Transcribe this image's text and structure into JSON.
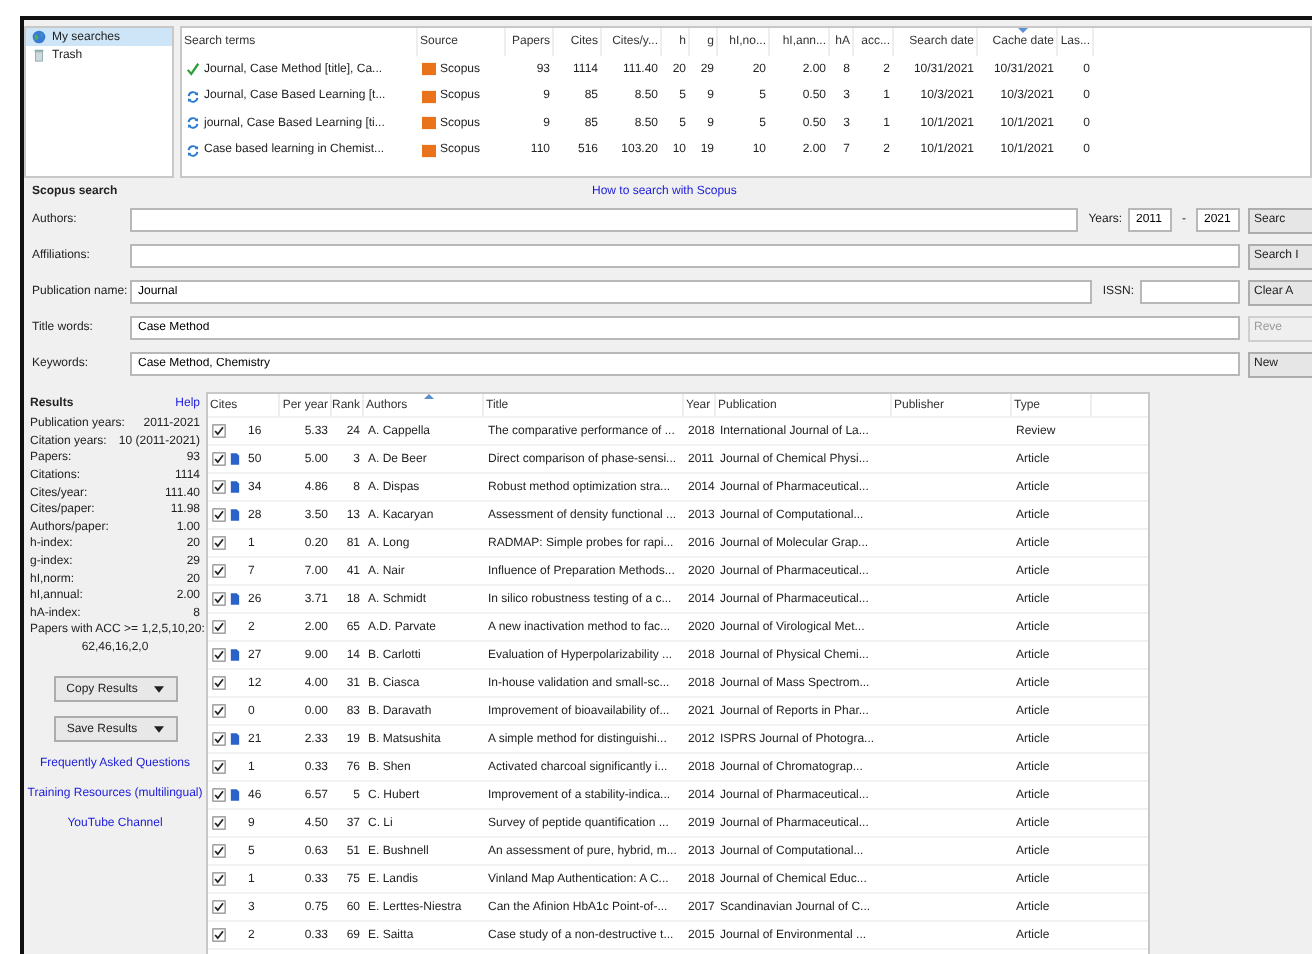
{
  "sidebar": {
    "items": [
      {
        "label": "My searches",
        "selected": true
      },
      {
        "label": "Trash",
        "selected": false
      }
    ]
  },
  "searches": {
    "columns": [
      {
        "label": "Search terms",
        "sorted": false
      },
      {
        "label": "Source",
        "sorted": false
      },
      {
        "label": "Papers",
        "sorted": false
      },
      {
        "label": "Cites",
        "sorted": false
      },
      {
        "label": "Cites/y...",
        "sorted": false
      },
      {
        "label": "h",
        "sorted": false
      },
      {
        "label": "g",
        "sorted": false
      },
      {
        "label": "hI,no...",
        "sorted": false
      },
      {
        "label": "hI,ann...",
        "sorted": false
      },
      {
        "label": "hA",
        "sorted": false
      },
      {
        "label": "acc...",
        "sorted": false
      },
      {
        "label": "Search date",
        "sorted": false
      },
      {
        "label": "Cache date",
        "sorted": true
      },
      {
        "label": "Las...",
        "sorted": false
      }
    ],
    "rows": [
      {
        "kind": "complete",
        "cells": [
          "Journal, Case Method [title], Ca...",
          "Scopus",
          "93",
          "1114",
          "111.40",
          "20",
          "29",
          "20",
          "2.00",
          "8",
          "2",
          "10/31/2021",
          "10/31/2021",
          "0"
        ]
      },
      {
        "kind": "cached",
        "cells": [
          "Journal, Case Based Learning [t...",
          "Scopus",
          "9",
          "85",
          "8.50",
          "5",
          "9",
          "5",
          "0.50",
          "3",
          "1",
          "10/3/2021",
          "10/3/2021",
          "0"
        ]
      },
      {
        "kind": "cached",
        "cells": [
          "journal, Case Based Learning [ti...",
          "Scopus",
          "9",
          "85",
          "8.50",
          "5",
          "9",
          "5",
          "0.50",
          "3",
          "1",
          "10/1/2021",
          "10/1/2021",
          "0"
        ]
      },
      {
        "kind": "cached",
        "cells": [
          "Case based learning in Chemist...",
          "Scopus",
          "110",
          "516",
          "103.20",
          "10",
          "19",
          "10",
          "2.00",
          "7",
          "2",
          "10/1/2021",
          "10/1/2021",
          "0"
        ]
      }
    ]
  },
  "search_form": {
    "title": "Scopus search",
    "help_link": "How to search with Scopus",
    "fields": [
      {
        "kind": "years",
        "label": "Authors:",
        "extra_label": "Years:",
        "from": "2011",
        "separator": "-",
        "to": "2021"
      },
      {
        "kind": "plain",
        "label": "Affiliations:"
      },
      {
        "kind": "issn",
        "label": "Publication name:",
        "value": "Journal",
        "extra_label": "ISSN:"
      },
      {
        "kind": "plain",
        "label": "Title words:",
        "value": "Case Method"
      },
      {
        "kind": "plain",
        "label": "Keywords:",
        "value": "Case Method, Chemistry"
      }
    ],
    "buttons": [
      {
        "label": "Searc",
        "disabled": false
      },
      {
        "label": "Search I",
        "disabled": false
      },
      {
        "label": "Clear A",
        "disabled": false
      },
      {
        "label": "Reve",
        "disabled": true
      },
      {
        "label": "New",
        "disabled": false
      }
    ]
  },
  "results": {
    "title": "Results",
    "help": "Help",
    "stats": [
      {
        "label": "Publication years:",
        "value": "2011-2021"
      },
      {
        "label": "Citation years:",
        "value": "10 (2011-2021)"
      },
      {
        "label": "Papers:",
        "value": "93"
      },
      {
        "label": "Citations:",
        "value": "1114"
      },
      {
        "label": "Cites/year:",
        "value": "111.40"
      },
      {
        "label": "Cites/paper:",
        "value": "11.98"
      },
      {
        "label": "Authors/paper:",
        "value": "1.00"
      },
      {
        "label": "h-index:",
        "value": "20"
      },
      {
        "label": "g-index:",
        "value": "29"
      },
      {
        "label": "hI,norm:",
        "value": "20"
      },
      {
        "label": "hI,annual:",
        "value": "2.00"
      },
      {
        "label": "hA-index:",
        "value": "8"
      }
    ],
    "acc": {
      "label": "Papers with ACC >= 1,2,5,10,20:",
      "value": "62,46,16,2,0"
    },
    "buttons": [
      "Copy Results",
      "Save Results"
    ],
    "links": [
      "Frequently Asked Questions",
      "Training Resources (multilingual)",
      "YouTube Channel"
    ],
    "columns": [
      {
        "label": "Cites",
        "sorted": false
      },
      {
        "label": "Per year",
        "sorted": false
      },
      {
        "label": "Rank",
        "sorted": false
      },
      {
        "label": "Authors",
        "sorted": true
      },
      {
        "label": "Title",
        "sorted": false
      },
      {
        "label": "Year",
        "sorted": false
      },
      {
        "label": "Publication",
        "sorted": false
      },
      {
        "label": "Publisher",
        "sorted": false
      },
      {
        "label": "Type",
        "sorted": false
      }
    ],
    "rows": [
      {
        "checked": true,
        "linked": false,
        "cites": "16",
        "per_year": "5.33",
        "rank": "24",
        "authors": "A. Cappella",
        "title": "The comparative performance of ...",
        "year": "2018",
        "publication": "International Journal of La...",
        "type": "Review"
      },
      {
        "checked": true,
        "linked": true,
        "cites": "50",
        "per_year": "5.00",
        "rank": "3",
        "authors": "A. De Beer",
        "title": "Direct comparison of phase-sensi...",
        "year": "2011",
        "publication": "Journal of Chemical Physi...",
        "type": "Article"
      },
      {
        "checked": true,
        "linked": true,
        "cites": "34",
        "per_year": "4.86",
        "rank": "8",
        "authors": "A. Dispas",
        "title": "Robust method optimization stra...",
        "year": "2014",
        "publication": "Journal of Pharmaceutical...",
        "type": "Article"
      },
      {
        "checked": true,
        "linked": true,
        "cites": "28",
        "per_year": "3.50",
        "rank": "13",
        "authors": "A. Kacaryan",
        "title": "Assessment of density functional ...",
        "year": "2013",
        "publication": "Journal of Computational...",
        "type": "Article"
      },
      {
        "checked": true,
        "linked": false,
        "cites": "1",
        "per_year": "0.20",
        "rank": "81",
        "authors": "A. Long",
        "title": "RADMAP: Simple probes for rapi...",
        "year": "2016",
        "publication": "Journal of Molecular Grap...",
        "type": "Article"
      },
      {
        "checked": true,
        "linked": false,
        "cites": "7",
        "per_year": "7.00",
        "rank": "41",
        "authors": "A. Nair",
        "title": "Influence of Preparation Methods...",
        "year": "2020",
        "publication": "Journal of Pharmaceutical...",
        "type": "Article"
      },
      {
        "checked": true,
        "linked": true,
        "cites": "26",
        "per_year": "3.71",
        "rank": "18",
        "authors": "A. Schmidt",
        "title": "In silico robustness testing of a c...",
        "year": "2014",
        "publication": "Journal of Pharmaceutical...",
        "type": "Article"
      },
      {
        "checked": true,
        "linked": false,
        "cites": "2",
        "per_year": "2.00",
        "rank": "65",
        "authors": "A.D. Parvate",
        "title": "A new inactivation method to fac...",
        "year": "2020",
        "publication": "Journal of Virological Met...",
        "type": "Article"
      },
      {
        "checked": true,
        "linked": true,
        "cites": "27",
        "per_year": "9.00",
        "rank": "14",
        "authors": "B. Carlotti",
        "title": "Evaluation of Hyperpolarizability ...",
        "year": "2018",
        "publication": "Journal of Physical Chemi...",
        "type": "Article"
      },
      {
        "checked": true,
        "linked": false,
        "cites": "12",
        "per_year": "4.00",
        "rank": "31",
        "authors": "B. Ciasca",
        "title": "In-house validation and small-sc...",
        "year": "2018",
        "publication": "Journal of Mass Spectrom...",
        "type": "Article"
      },
      {
        "checked": true,
        "linked": false,
        "cites": "0",
        "per_year": "0.00",
        "rank": "83",
        "authors": "B. Daravath",
        "title": "Improvement of bioavailability of...",
        "year": "2021",
        "publication": "Journal of Reports in Phar...",
        "type": "Article"
      },
      {
        "checked": true,
        "linked": true,
        "cites": "21",
        "per_year": "2.33",
        "rank": "19",
        "authors": "B. Matsushita",
        "title": "A simple method for distinguishi...",
        "year": "2012",
        "publication": "ISPRS Journal of Photogra...",
        "type": "Article"
      },
      {
        "checked": true,
        "linked": false,
        "cites": "1",
        "per_year": "0.33",
        "rank": "76",
        "authors": "B. Shen",
        "title": "Activated charcoal significantly i...",
        "year": "2018",
        "publication": "Journal of Chromatograp...",
        "type": "Article"
      },
      {
        "checked": true,
        "linked": true,
        "cites": "46",
        "per_year": "6.57",
        "rank": "5",
        "authors": "C. Hubert",
        "title": "Improvement of a stability-indica...",
        "year": "2014",
        "publication": "Journal of Pharmaceutical...",
        "type": "Article"
      },
      {
        "checked": true,
        "linked": false,
        "cites": "9",
        "per_year": "4.50",
        "rank": "37",
        "authors": "C. Li",
        "title": "Survey of peptide quantification ...",
        "year": "2019",
        "publication": "Journal of Pharmaceutical...",
        "type": "Article"
      },
      {
        "checked": true,
        "linked": false,
        "cites": "5",
        "per_year": "0.63",
        "rank": "51",
        "authors": "E. Bushnell",
        "title": "An assessment of pure, hybrid, m...",
        "year": "2013",
        "publication": "Journal of Computational...",
        "type": "Article"
      },
      {
        "checked": true,
        "linked": false,
        "cites": "1",
        "per_year": "0.33",
        "rank": "75",
        "authors": "E. Landis",
        "title": "Vinland Map Authentication: A C...",
        "year": "2018",
        "publication": "Journal of Chemical Educ...",
        "type": "Article"
      },
      {
        "checked": true,
        "linked": false,
        "cites": "3",
        "per_year": "0.75",
        "rank": "60",
        "authors": "E. Lerttes-Niestra",
        "title": "Can the Afinion HbA1c Point-of-...",
        "year": "2017",
        "publication": "Scandinavian Journal of C...",
        "type": "Article"
      },
      {
        "checked": true,
        "linked": false,
        "cites": "2",
        "per_year": "0.33",
        "rank": "69",
        "authors": "E. Saitta",
        "title": "Case study of a non-destructive t...",
        "year": "2015",
        "publication": "Journal of Environmental ...",
        "type": "Article"
      }
    ]
  }
}
